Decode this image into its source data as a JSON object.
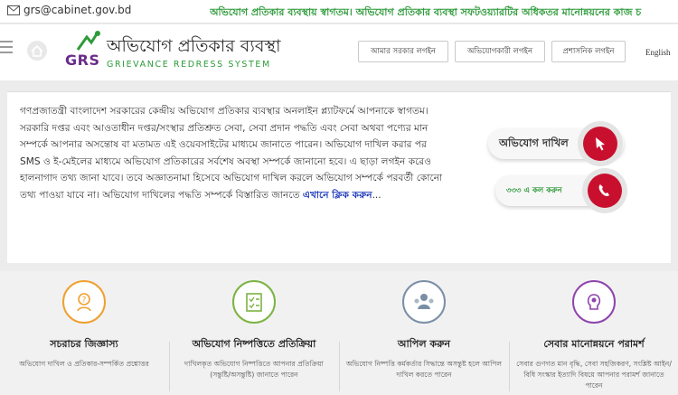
{
  "topbar": {
    "email": "grs@cabinet.gov.bd",
    "marquee": "অভিযোগ প্রতিকার ব্যবস্থায় স্বাগতম। অভিযোগ প্রতিকার ব্যবস্থা সফটওয়্যারটির অধিকতর মানোন্নয়নের কাজ চ"
  },
  "logo": {
    "mark": "GRS",
    "title": "অভিযোগ প্রতিকার ব্যবস্থা",
    "subtitle": "GRIEVANCE REDRESS SYSTEM"
  },
  "header": {
    "login_buttons": [
      "আমার সরকার লগইন",
      "অভিযোগকারী লগইন",
      "প্রশাসনিক লগইন"
    ],
    "language": "English"
  },
  "welcome": {
    "text": "গণপ্রজাতন্ত্রী বাংলাদেশ সরকারের কেন্দ্রীয় অভিযোগ প্রতিকার ব্যবস্থার অনলাইন প্ল্যাটফর্মে আপনাকে স্বাগতম। সরকারি দপ্তর এবং আওতাধীন দপ্তর/সংস্থার প্রতিশ্রুত সেবা, সেবা প্রদান পদ্ধতি এবং সেবা অথবা পণ্যের মান সম্পর্কে আপনার অসন্তোষ বা মতামত এই ওয়েবসাইটের মাধ্যমে জানাতে পারেন। অভিযোগ দাখিল করার পর SMS ও ই-মেইলের মাধ্যমে অভিযোগ প্রতিকারের সর্বশেষ অবস্থা সম্পর্কে জানানো হবে। এ ছাড়া লগইন করেও হালনাগাদ তথ্য জানা যাবে। তবে অজ্ঞাতনামা হিসেবে অভিযোগ দাখিল করলে অভিযোগ সম্পর্কে পরবর্তী কোনো তথ্য পাওয়া যাবে না। অভিযোগ দাখিলের পদ্ধতি সম্পর্কে বিস্তারিত জানতে ",
    "link": "এখানে ক্লিক করুন",
    "link_suffix": "..."
  },
  "actions": {
    "submit_label": "অভিযোগ দাখিল",
    "call_label": "৩৩৩ এ কল করুন",
    "accent": "#c8102e"
  },
  "features": [
    {
      "title": "সচরাচর জিজ্ঞাস্য",
      "desc": "অভিযোগ দাখিল ও প্রতিকার-সম্পর্কিত প্রশ্নোত্তর",
      "color": "#f0a030",
      "icon": "faq-person-icon"
    },
    {
      "title": "অভিযোগ নিষ্পত্তিতে প্রতিক্রিয়া",
      "desc": "দাখিলকৃত অভিযোগ নিষ্পত্তিতে আপনার প্রতিক্রিয়া (সন্তুষ্টি/অসন্তুষ্টি) জানাতে পারেন",
      "color": "#7cb342",
      "icon": "checklist-icon"
    },
    {
      "title": "আপিল করুন",
      "desc": "অভিযোগ নিষ্পত্তি কর্মকর্তার সিদ্ধান্তে অসন্তুষ্ট হলে আপিল দাখিল করতে পারেন",
      "color": "#7a8fa6",
      "icon": "appeal-group-icon"
    },
    {
      "title": "সেবার মানোন্নয়নে পরামর্শ",
      "desc": "সেবার গুণগত মান বৃদ্ধি, সেবা সহজিকরণ, সংশ্লিষ্ট আইন/বিধি সংস্কার ইত্যাদি বিষয়ে আপনার পরামর্শ জানাতে পারেন",
      "color": "#8e44ad",
      "icon": "lightbulb-head-icon"
    }
  ]
}
